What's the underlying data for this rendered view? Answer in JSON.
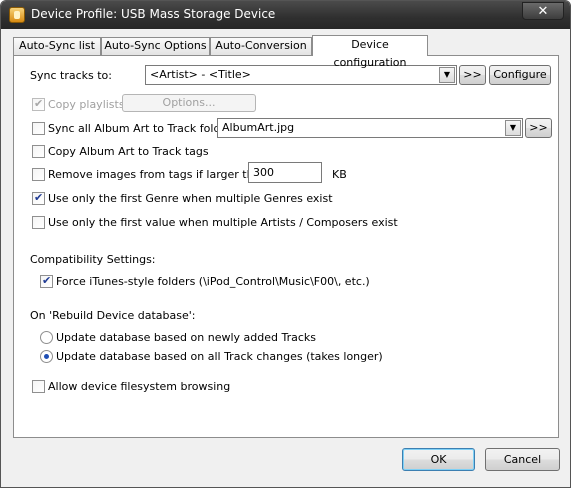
{
  "window": {
    "title": "Device Profile: USB Mass Storage Device",
    "close_label": "✕"
  },
  "tabs": [
    {
      "label": "Auto-Sync list",
      "active": false
    },
    {
      "label": "Auto-Sync Options",
      "active": false
    },
    {
      "label": "Auto-Conversion",
      "active": false
    },
    {
      "label": "Device configuration",
      "active": true
    }
  ],
  "sync_tracks": {
    "label": "Sync tracks to:",
    "value": "<Artist> - <Title>",
    "more_label": ">>",
    "configure_label": "Configure"
  },
  "copy_playlists": {
    "label": "Copy playlists",
    "checked": true,
    "enabled": false,
    "options_label": "Options..."
  },
  "album_art_folders": {
    "label": "Sync all Album Art to Track folders",
    "checked": false,
    "value": "AlbumArt.jpg",
    "more_label": ">>"
  },
  "copy_album_art": {
    "label": "Copy Album Art to Track tags",
    "checked": false
  },
  "remove_images": {
    "label": "Remove images from tags if larger than:",
    "checked": false,
    "value": "300",
    "unit": "KB"
  },
  "first_genre": {
    "label": "Use only the first Genre when multiple Genres exist",
    "checked": true
  },
  "first_value": {
    "label": "Use only the first value when multiple Artists / Composers exist",
    "checked": false
  },
  "compatibility": {
    "heading": "Compatibility Settings:",
    "force_itunes_label": "Force iTunes-style folders (\\iPod_Control\\Music\\F00\\, etc.)",
    "force_itunes_checked": true
  },
  "rebuild": {
    "heading": "On 'Rebuild Device database':",
    "options": [
      {
        "label": "Update database based on newly added Tracks",
        "selected": false
      },
      {
        "label": "Update database based on all Track changes (takes longer)",
        "selected": true
      }
    ]
  },
  "filesystem": {
    "label": "Allow device filesystem browsing",
    "checked": false
  },
  "footer": {
    "ok_label": "OK",
    "cancel_label": "Cancel"
  }
}
